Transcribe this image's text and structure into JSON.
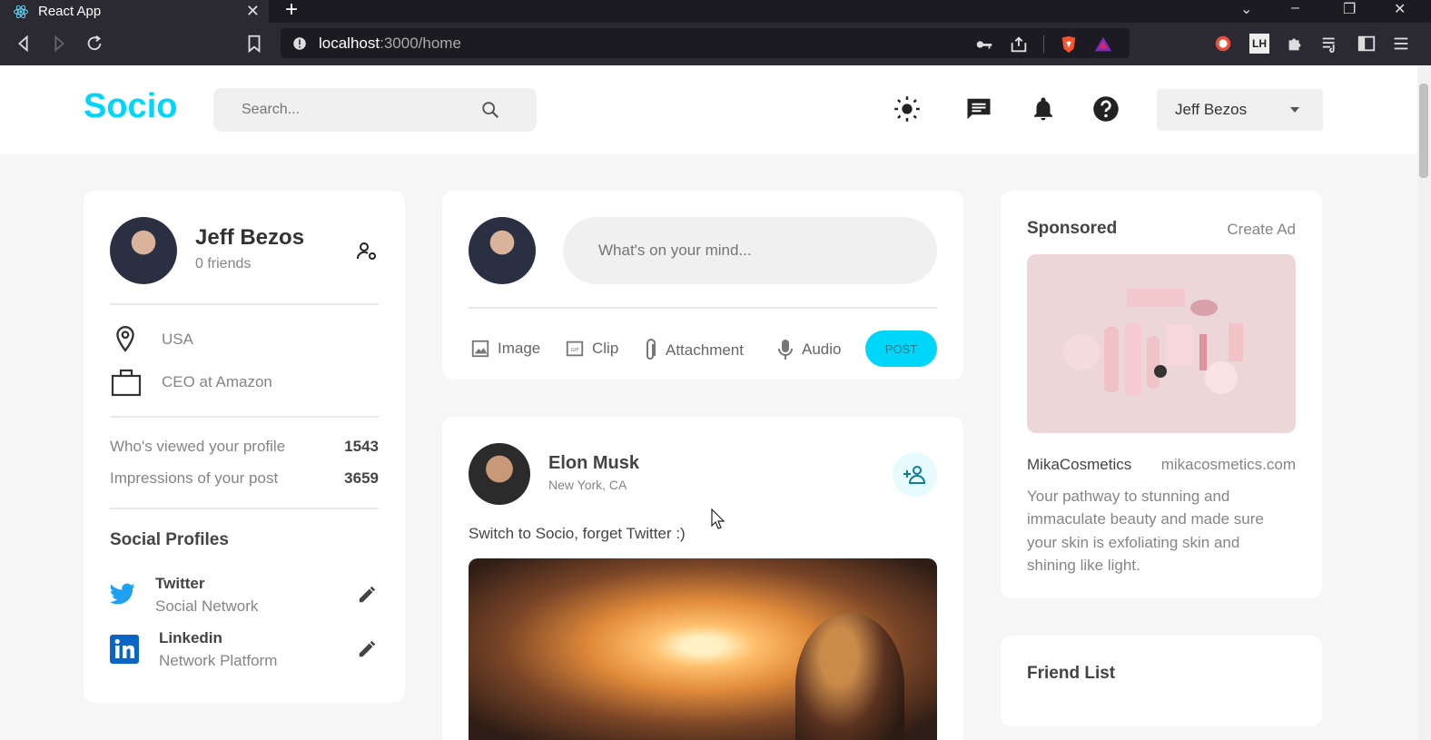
{
  "browser": {
    "tab_title": "React App",
    "url_host": "localhost",
    "url_path": ":3000/home"
  },
  "nav": {
    "logo": "Socio",
    "search_placeholder": "Search...",
    "user_name": "Jeff Bezos"
  },
  "profile": {
    "name": "Jeff Bezos",
    "friends": "0 friends",
    "location": "USA",
    "occupation": "CEO at Amazon",
    "stats": [
      {
        "label": "Who's viewed your profile",
        "value": "1543"
      },
      {
        "label": "Impressions of your post",
        "value": "3659"
      }
    ],
    "social_title": "Social Profiles",
    "socials": [
      {
        "name": "Twitter",
        "type": "Social Network"
      },
      {
        "name": "Linkedin",
        "type": "Network Platform"
      }
    ]
  },
  "composer": {
    "placeholder": "What's on your mind...",
    "actions": [
      "Image",
      "Clip",
      "Attachment",
      "Audio"
    ],
    "post_label": "POST"
  },
  "post": {
    "author": "Elon Musk",
    "location": "New York, CA",
    "text": "Switch to Socio, forget Twitter :)"
  },
  "ad": {
    "title": "Sponsored",
    "create_label": "Create Ad",
    "brand": "MikaCosmetics",
    "site": "mikacosmetics.com",
    "description_lines": [
      "Your pathway to stunning and",
      "immaculate beauty and made sure",
      "your skin is exfoliating skin and",
      "shining like light."
    ]
  },
  "friends": {
    "title": "Friend List"
  },
  "colors": {
    "brand": "#00d5fa",
    "twitter": "#1da1f2",
    "linkedin": "#0a66c2"
  }
}
